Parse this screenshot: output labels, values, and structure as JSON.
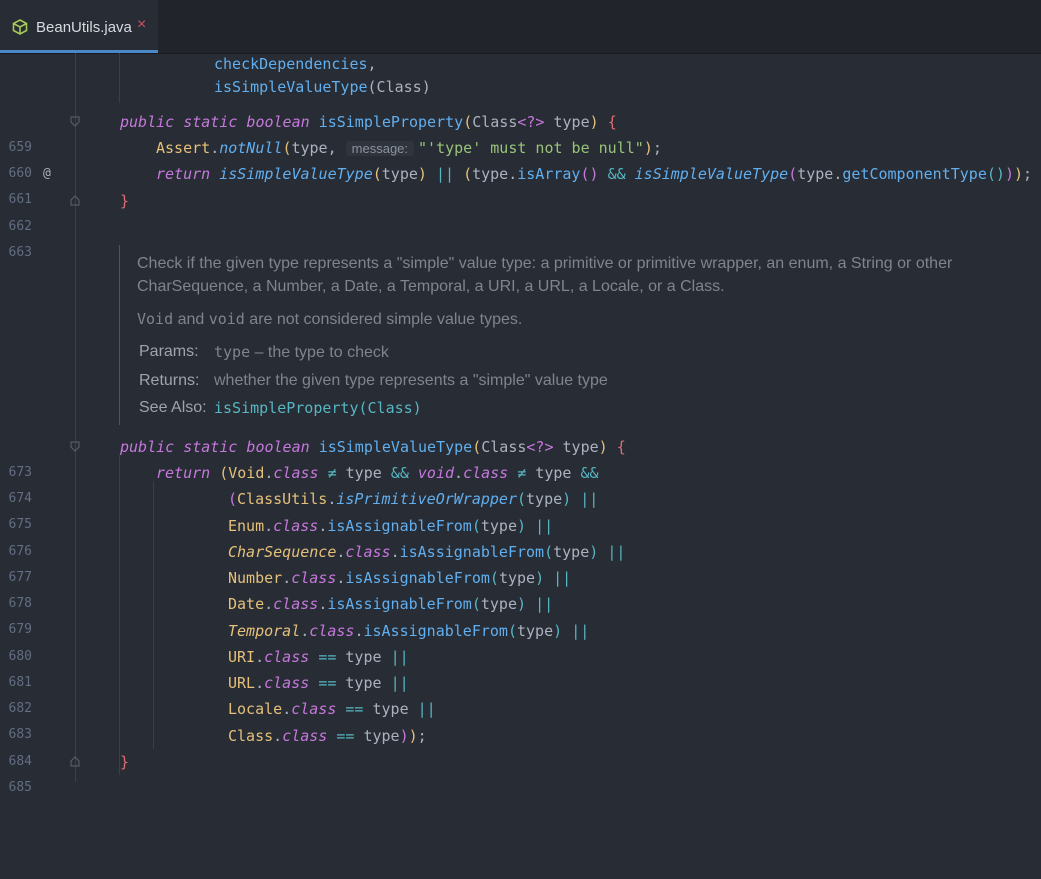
{
  "tab": {
    "title": "BeanUtils.java",
    "close": "×",
    "icon": "java-class-icon"
  },
  "lines": {
    "l1": {
      "a": "checkDependencies",
      "b": ","
    },
    "l2": {
      "a": "isSimpleValueType",
      "b": "(Class)"
    },
    "l659": {
      "n": "659",
      "mark": "@"
    },
    "l660": {
      "n": "660",
      "hint": "message:",
      "str": "\"'type' must not be null\""
    },
    "l661": {
      "n": "661"
    },
    "l662": {
      "n": "662"
    },
    "l663": {
      "n": "663"
    },
    "l673": {
      "n": "673"
    },
    "l674": {
      "n": "674"
    },
    "l675": {
      "n": "675"
    },
    "l676": {
      "n": "676"
    },
    "l677": {
      "n": "677"
    },
    "l678": {
      "n": "678"
    },
    "l679": {
      "n": "679"
    },
    "l680": {
      "n": "680"
    },
    "l681": {
      "n": "681"
    },
    "l682": {
      "n": "682"
    },
    "l683": {
      "n": "683"
    },
    "l684": {
      "n": "684"
    },
    "l685": {
      "n": "685"
    }
  },
  "doc": {
    "para1": "Check if the given type represents a \"simple\" value type: a primitive or primitive wrapper, an enum, a String or other CharSequence, a Number, a Date, a Temporal, a URI, a URL, a Locale, or a Class.",
    "void1": "Void",
    "and": " and ",
    "void2": "void",
    "para2_rest": " are not considered simple value types.",
    "params_label": "Params:",
    "params_code": "type",
    "params_text": " – the type to check",
    "returns_label": "Returns:",
    "returns_text": "whether the given type represents a \"simple\" value type",
    "see_label": "See Also:",
    "see_link": "isSimpleProperty(Class)"
  },
  "colors": {
    "background": "#282c34",
    "keyword": "#c678dd",
    "function": "#61afef",
    "type": "#e5c07b",
    "string": "#98c379",
    "comment": "#7f848e",
    "tab_accent": "#4a88c7"
  }
}
